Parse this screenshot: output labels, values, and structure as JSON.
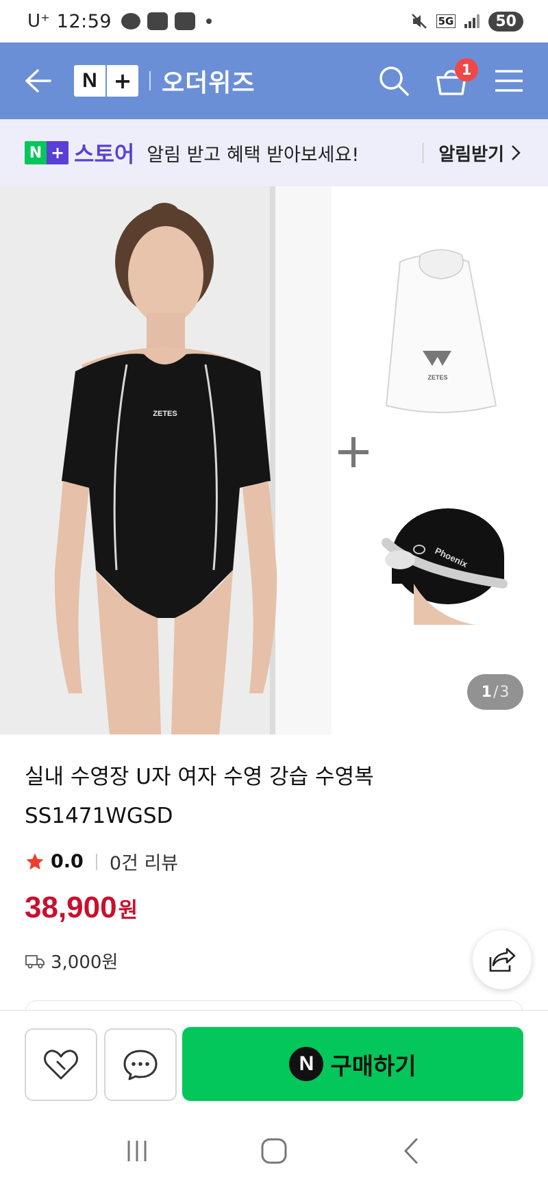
{
  "status_bar": {
    "time": "12:59",
    "carrier": "U⁺",
    "battery": "50",
    "network": "5G"
  },
  "header": {
    "brand_n": "N",
    "brand_plus": "+",
    "store_name": "오더위즈",
    "cart_count": "1",
    "bg_color": "#6b8fd6"
  },
  "notify_banner": {
    "logo_n": "N",
    "logo_plus": "+",
    "logo_text": "스토어",
    "message": "알림 받고 혜택 받아보세요!",
    "action_label": "알림받기"
  },
  "gallery": {
    "current_page": "1",
    "separator": "/",
    "total_pages": "3",
    "swimsuit_logo": "ZETES",
    "bag_logo": "ZETES",
    "cap_logo": "Phoenix"
  },
  "product": {
    "title_line1": "실내 수영장 U자 여자 수영 강습 수영복",
    "title_line2": "SS1471WGSD",
    "rating_score": "0.0",
    "review_count": "0건 리뷰",
    "price_value": "38,900",
    "price_unit": "원",
    "shipping_fee": "3,000원",
    "price_color": "#c8102e"
  },
  "actions": {
    "buy_n": "N",
    "buy_label": "구매하기",
    "buy_color": "#03c75a"
  },
  "icons": {
    "back": "arrow-left-icon",
    "search": "search-icon",
    "cart": "cart-icon",
    "menu": "hamburger-menu-icon",
    "wishlist": "heart-icon",
    "chat": "chat-bubble-icon",
    "share": "share-icon",
    "shipping": "truck-icon",
    "star": "star-icon"
  }
}
